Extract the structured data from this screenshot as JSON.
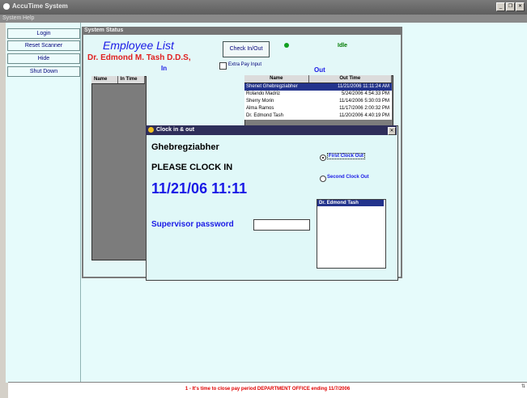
{
  "app": {
    "title": "AccuTime System"
  },
  "menu": {
    "items": [
      "System",
      "Help"
    ]
  },
  "nav": {
    "buttons": [
      "Login",
      "Reset Scanner",
      "Hide",
      "Shut Down"
    ]
  },
  "status_panel": {
    "header": "System Status",
    "title": "Employee List",
    "doctor": "Dr. Edmond M. Tash D.D.S,",
    "in_label": "In",
    "out_label": "Out",
    "check_button": "Check In/Out",
    "status_text": "Idle",
    "status_color": "#10a020",
    "extra_pay_label": "Extra Pay Input",
    "extra_pay_checked": false
  },
  "in_table": {
    "columns": [
      "Name",
      "In Time"
    ],
    "rows": []
  },
  "out_table": {
    "columns": [
      "Name",
      "Out Time"
    ],
    "rows": [
      {
        "name": "Shenet Ghebregziabher",
        "time": "11/21/2006 11:11:24 AM",
        "selected": true
      },
      {
        "name": "Rolando Madriz",
        "time": "5/24/2006 4:54:33 PM"
      },
      {
        "name": "Sherry Morin",
        "time": "11/14/2006 5:30:03 PM"
      },
      {
        "name": "Alma Ramos",
        "time": "11/17/2006 2:00:32 PM"
      },
      {
        "name": "Dr. Edmond Tash",
        "time": "11/20/2006 4:40:19 PM"
      }
    ]
  },
  "dialog": {
    "title": "Clock in & out",
    "employee": "Ghebregziabher",
    "prompt": "PLEASE CLOCK IN",
    "datetime": "11/21/06 11:11",
    "radio_first": "First Clock Out",
    "radio_second": "Second Clock Out",
    "radio_selected": "first",
    "supervisor_label": "Supervisor password",
    "password_value": "",
    "supervisors": [
      "Dr. Edmond Tash"
    ]
  },
  "footer": {
    "message": "1 - It's time to close pay period  DEPARTMENT OFFICE  ending 11/7/2006"
  },
  "colors": {
    "accent_blue": "#1a1ae6",
    "alert_red": "#e02020",
    "selection": "#23338c"
  }
}
